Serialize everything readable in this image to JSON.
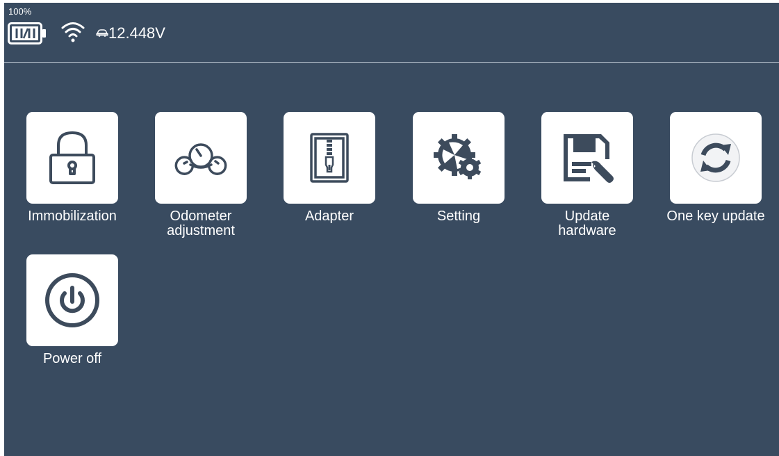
{
  "status": {
    "battery_percent": "100%",
    "voltage": "12.448V",
    "icons": [
      "battery-icon",
      "wifi-icon",
      "car-icon"
    ]
  },
  "apps": [
    {
      "label": "Immobilization",
      "icon": "padlock-icon"
    },
    {
      "label": "Odometer\nadjustment",
      "icon": "gauges-icon"
    },
    {
      "label": "Adapter",
      "icon": "zipper-icon"
    },
    {
      "label": "Setting",
      "icon": "gears-icon"
    },
    {
      "label": "Update\nhardware",
      "icon": "floppy-wrench-icon"
    },
    {
      "label": "One key update",
      "icon": "refresh-icon"
    },
    {
      "label": "Power off",
      "icon": "power-icon"
    }
  ],
  "colors": {
    "background": "#394b60",
    "tile": "#ffffff",
    "icon": "#3d4b5c"
  }
}
